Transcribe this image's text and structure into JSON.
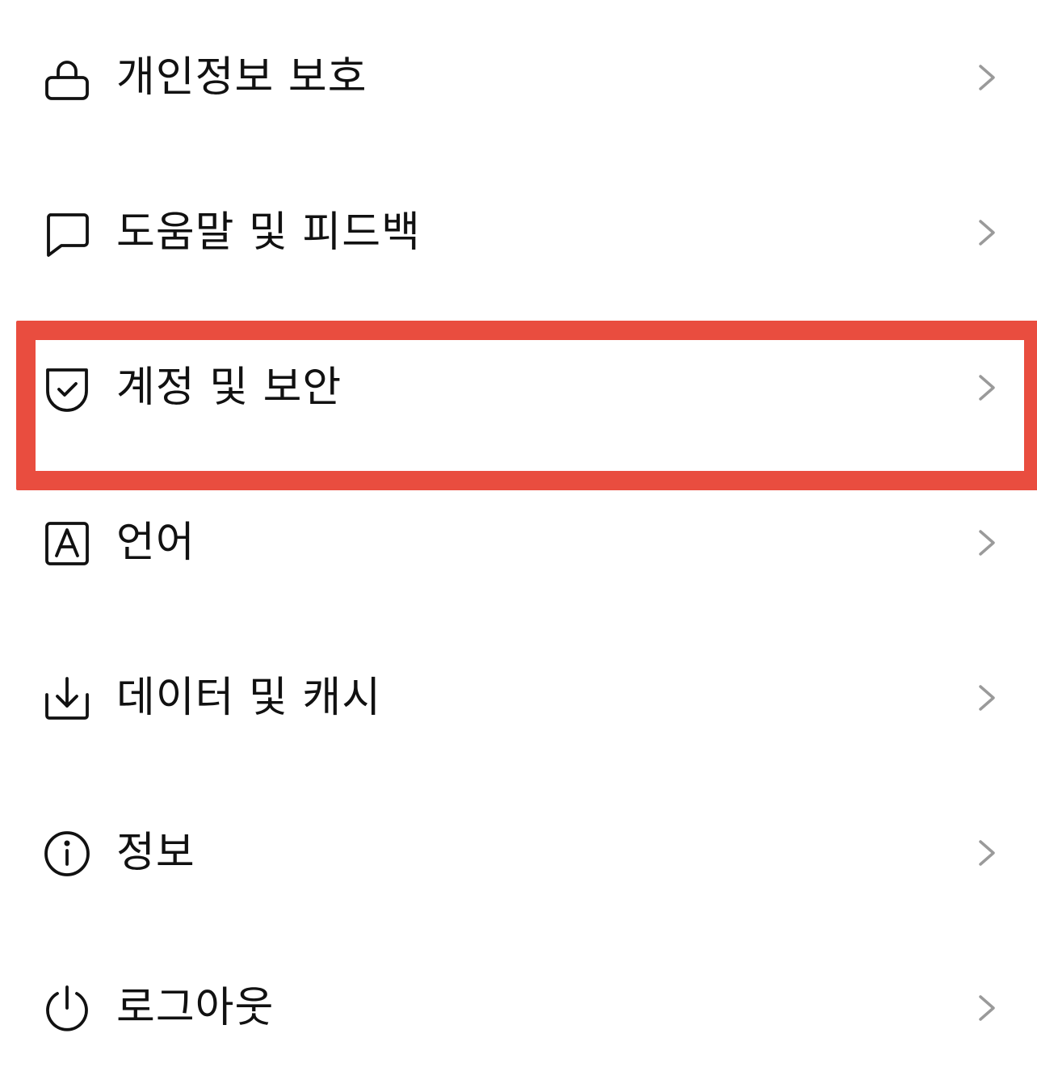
{
  "menu": {
    "items": [
      {
        "label": "개인정보 보호",
        "icon": "lock-icon"
      },
      {
        "label": "도움말 및 피드백",
        "icon": "chat-bubble-icon"
      },
      {
        "label": "계정 및 보안",
        "icon": "shield-check-icon"
      },
      {
        "label": "언어",
        "icon": "language-icon"
      },
      {
        "label": "데이터 및 캐시",
        "icon": "download-icon"
      },
      {
        "label": "정보",
        "icon": "info-icon"
      },
      {
        "label": "로그아웃",
        "icon": "power-icon"
      }
    ],
    "highlighted_index": 2
  },
  "colors": {
    "text": "#111111",
    "chevron": "#9a9a9a",
    "highlight": "#e94d3f",
    "background": "#ffffff"
  }
}
